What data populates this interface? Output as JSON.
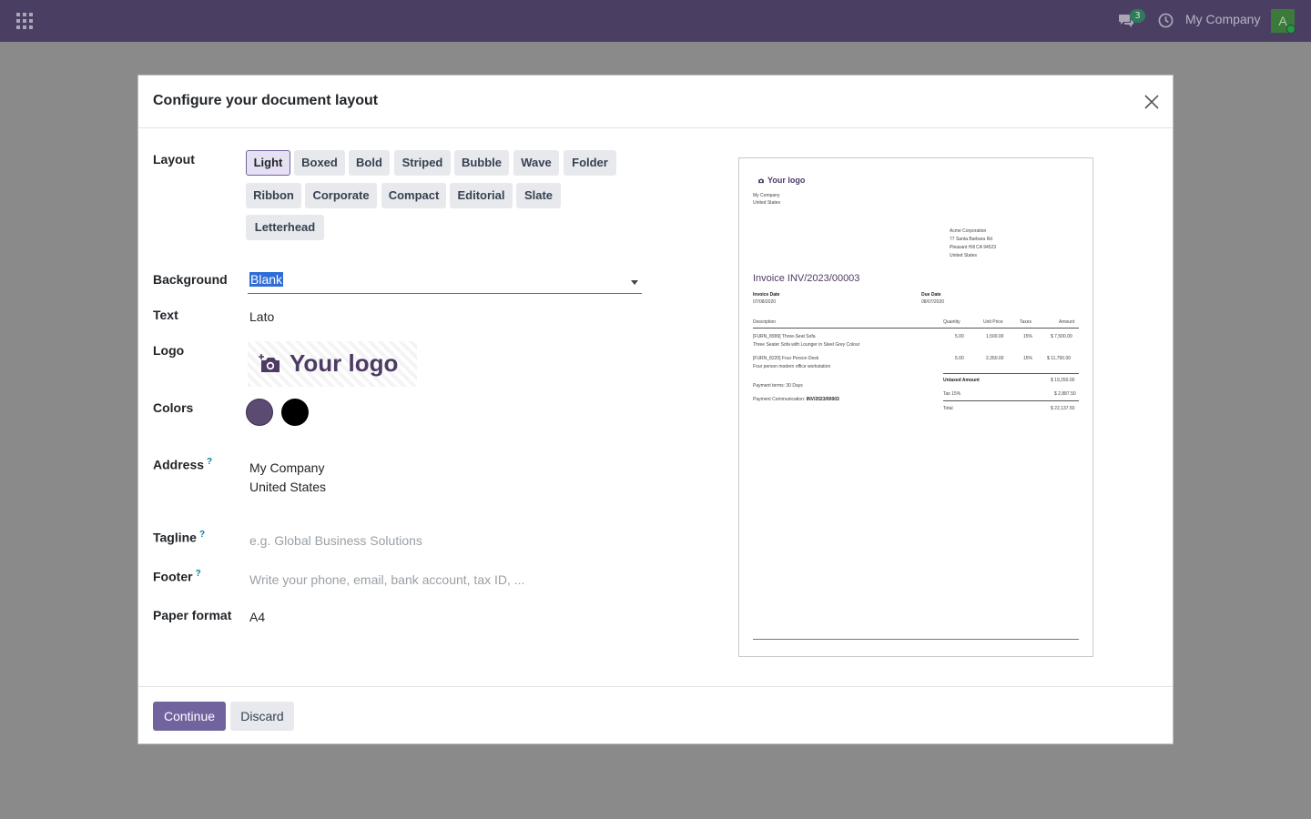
{
  "navbar": {
    "chat_count": "3",
    "company": "My Company",
    "avatar_initial": "A"
  },
  "modal": {
    "title": "Configure your document layout",
    "fields": {
      "layout_label": "Layout",
      "background_label": "Background",
      "text_label": "Text",
      "logo_label": "Logo",
      "colors_label": "Colors",
      "address_label": "Address",
      "tagline_label": "Tagline",
      "footer_label": "Footer",
      "paper_format_label": "Paper format",
      "help_mark": "?"
    },
    "layouts": [
      "Light",
      "Boxed",
      "Bold",
      "Striped",
      "Bubble",
      "Wave",
      "Folder",
      "Ribbon",
      "Corporate",
      "Compact",
      "Editorial",
      "Slate",
      "Letterhead"
    ],
    "selected_layout": "Light",
    "background_value": "Blank",
    "text_value": "Lato",
    "logo_text": "Your logo",
    "colors": {
      "primary": "#5b4a72",
      "secondary": "#000000"
    },
    "address_line1": "My Company",
    "address_line2": "United States",
    "tagline_placeholder": "e.g. Global Business Solutions",
    "footer_placeholder": "Write your phone, email, bank account, tax ID, ...",
    "paper_format_value": "A4",
    "continue_label": "Continue",
    "discard_label": "Discard"
  },
  "preview": {
    "logo": "Your logo",
    "company_line1": "My Company",
    "company_line2": "United States",
    "customer": [
      "Acme Corporation",
      "77 Santa Barbara Rd",
      "Pleasant Hill CA 94523",
      "United States"
    ],
    "invoice_title": "Invoice INV/2023/00003",
    "invoice_date_label": "Invoice Date",
    "invoice_date": "07/08/2020",
    "due_date_label": "Due Date",
    "due_date": "08/07/2020",
    "columns": [
      "Description",
      "Quantity",
      "Unit Price",
      "Taxes",
      "Amount"
    ],
    "rows": [
      {
        "desc1": "[FURN_8999] Three-Seat Sofa",
        "desc2": "Three Seater Sofa with Lounger in Steel Grey Colour",
        "qty": "5.00",
        "price": "1,500.00",
        "tax": "15%",
        "amount": "$ 7,500.00"
      },
      {
        "desc1": "[FURN_8220] Four Person Desk",
        "desc2": "Four person modern office workstation",
        "qty": "5.00",
        "price": "2,350.00",
        "tax": "15%",
        "amount": "$ 11,750.00"
      }
    ],
    "untaxed_label": "Untaxed Amount",
    "untaxed_value": "$ 19,250.00",
    "tax_label": "Tax 15%",
    "tax_value": "$ 2,887.50",
    "total_label": "Total",
    "total_value": "$ 22,137.50",
    "payment_terms": "Payment terms: 30 Days",
    "payment_comm_label": "Payment Communication:",
    "payment_comm_value": "INV/2023/00003"
  }
}
